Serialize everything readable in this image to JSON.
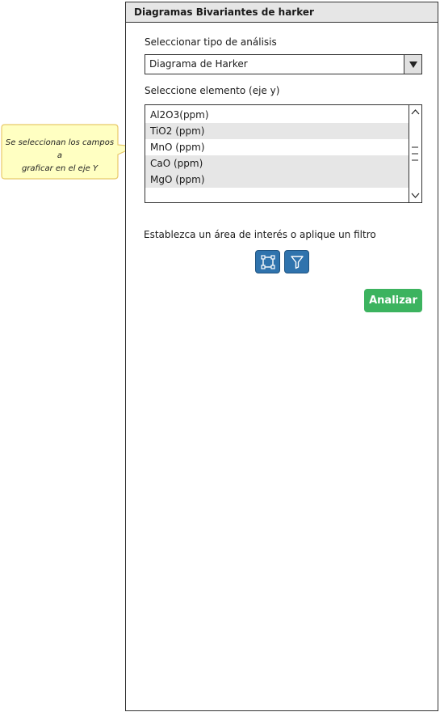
{
  "panel": {
    "title": "Diagramas Bivariantes de harker",
    "analysis_type_label": "Seleccionar tipo de análisis",
    "analysis_type_value": "Diagrama de Harker",
    "element_label": "Seleccione elemento (eje y)",
    "elements": [
      "Al2O3(ppm)",
      "TiO2 (ppm)",
      "MnO (ppm)",
      "CaO (ppm)",
      "MgO (ppm)"
    ],
    "filter_label": "Establezca un área de interés o aplique un filtro",
    "analyze_label": "Analizar"
  },
  "callout": {
    "line1": "Se seleccionan los campos a",
    "line2": "graficar en el eje Y"
  },
  "icons": {
    "select_dropdown": "triangle-down-icon",
    "area_select": "bounding-box-icon",
    "filter": "funnel-icon"
  },
  "colors": {
    "primary_button": "#2f73ad",
    "analyze_button": "#3cb35f",
    "callout_fill": "#ffffc2",
    "callout_border": "#e8c96a"
  }
}
